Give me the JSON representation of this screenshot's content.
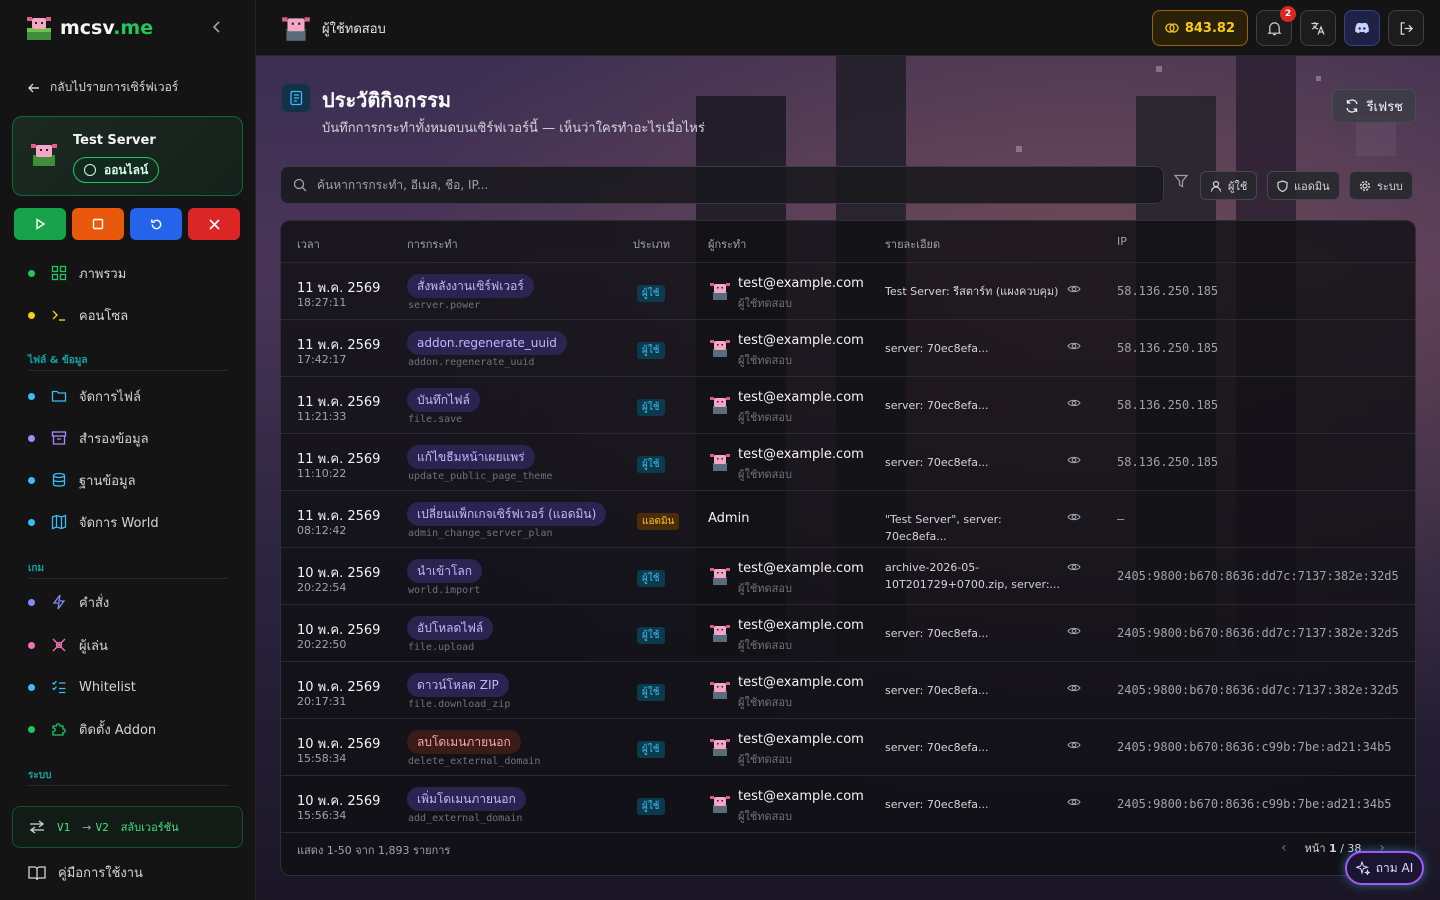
{
  "brand": {
    "name": "mcsv",
    "tld": ".me"
  },
  "sidebar": {
    "back_label": "กลับไปรายการเซิร์ฟเวอร์",
    "server": {
      "name": "Test Server",
      "status": "ออนไลน์"
    },
    "nav_main": [
      {
        "label": "ภาพรวม",
        "icon": "dashboard-icon",
        "dot": "#22c55e"
      },
      {
        "label": "คอนโซล",
        "icon": "terminal-icon",
        "dot": "#facc15"
      }
    ],
    "section_files": "ไฟล์ & ข้อมูล",
    "nav_files": [
      {
        "label": "จัดการไฟล์",
        "icon": "folder-icon",
        "dot": "#38bdf8"
      },
      {
        "label": "สำรองข้อมูล",
        "icon": "archive-icon",
        "dot": "#a78bfa"
      },
      {
        "label": "ฐานข้อมูล",
        "icon": "database-icon",
        "dot": "#38bdf8"
      },
      {
        "label": "จัดการ World",
        "icon": "map-icon",
        "dot": "#38bdf8"
      }
    ],
    "section_game": "เกม",
    "nav_game": [
      {
        "label": "คำสั่ง",
        "icon": "lightning-icon",
        "dot": "#818cf8"
      },
      {
        "label": "ผู้เล่น",
        "icon": "players-icon",
        "dot": "#f472b6"
      },
      {
        "label": "Whitelist",
        "icon": "checklist-icon",
        "dot": "#38bdf8"
      },
      {
        "label": "ติดตั้ง Addon",
        "icon": "puzzle-icon",
        "dot": "#22c55e"
      }
    ],
    "section_system": "ระบบ",
    "version_switch": {
      "from": "V1",
      "to": "V2",
      "label": "สลับเวอร์ชัน"
    },
    "guide_label": "คู่มือการใช้งาน"
  },
  "topbar": {
    "title": "ผู้ใช้ทดสอบ",
    "credit": "843.82",
    "notifications": "2"
  },
  "page": {
    "title": "ประวัติกิจกรรม",
    "subtitle": "บันทึกการกระทำทั้งหมดบนเซิร์ฟเวอร์นี้ — เห็นว่าใครทำอะไรเมื่อไหร่",
    "refresh_label": "รีเฟรช",
    "search_placeholder": "ค้นหาการกระทำ, อีเมล, ชื่อ, IP...",
    "filters": {
      "user": "ผู้ใช้",
      "admin": "แอดมิน",
      "system": "ระบบ"
    }
  },
  "table": {
    "headers": {
      "time": "เวลา",
      "action": "การกระทำ",
      "type": "ประเภท",
      "actor": "ผู้กระทำ",
      "detail": "รายละเอียด",
      "ip": "IP"
    },
    "rows": [
      {
        "date": "11 พ.ค. 2569",
        "time": "18:27:11",
        "action": "สั่งพลังงานเซิร์ฟเวอร์",
        "code": "server.power",
        "type": "ผู้ใช้",
        "email": "test@example.com",
        "user": "ผู้ใช้ทดสอบ",
        "detail": "Test Server: รีสตาร์ท (แผงควบคุม)",
        "ip": "58.136.250.185"
      },
      {
        "date": "11 พ.ค. 2569",
        "time": "17:42:17",
        "action": "addon.regenerate_uuid",
        "code": "addon.regenerate_uuid",
        "type": "ผู้ใช้",
        "email": "test@example.com",
        "user": "ผู้ใช้ทดสอบ",
        "detail": "server: 70ec8efa...",
        "ip": "58.136.250.185"
      },
      {
        "date": "11 พ.ค. 2569",
        "time": "11:21:33",
        "action": "บันทึกไฟล์",
        "code": "file.save",
        "type": "ผู้ใช้",
        "email": "test@example.com",
        "user": "ผู้ใช้ทดสอบ",
        "detail": "server: 70ec8efa...",
        "ip": "58.136.250.185"
      },
      {
        "date": "11 พ.ค. 2569",
        "time": "11:10:22",
        "action": "แก้ไขธีมหน้าเผยแพร่",
        "code": "update_public_page_theme",
        "type": "ผู้ใช้",
        "email": "test@example.com",
        "user": "ผู้ใช้ทดสอบ",
        "detail": "server: 70ec8efa...",
        "ip": "58.136.250.185"
      },
      {
        "date": "11 พ.ค. 2569",
        "time": "08:12:42",
        "action": "เปลี่ยนแพ็กเกจเซิร์ฟเวอร์ (แอดมิน)",
        "code": "admin_change_server_plan",
        "type": "แอดมิน",
        "actor": "Admin",
        "detail": "\"Test Server\", server: 70ec8efa...",
        "ip": "–"
      },
      {
        "date": "10 พ.ค. 2569",
        "time": "20:22:54",
        "action": "นำเข้าโลก",
        "code": "world.import",
        "type": "ผู้ใช้",
        "email": "test@example.com",
        "user": "ผู้ใช้ทดสอบ",
        "detail": "archive-2026-05-10T201729+0700.zip, server:...",
        "ip": "2405:9800:b670:8636:dd7c:7137:382e:32d5"
      },
      {
        "date": "10 พ.ค. 2569",
        "time": "20:22:50",
        "action": "อัปโหลดไฟล์",
        "code": "file.upload",
        "type": "ผู้ใช้",
        "email": "test@example.com",
        "user": "ผู้ใช้ทดสอบ",
        "detail": "server: 70ec8efa...",
        "ip": "2405:9800:b670:8636:dd7c:7137:382e:32d5"
      },
      {
        "date": "10 พ.ค. 2569",
        "time": "20:17:31",
        "action": "ดาวน์โหลด ZIP",
        "code": "file.download_zip",
        "type": "ผู้ใช้",
        "email": "test@example.com",
        "user": "ผู้ใช้ทดสอบ",
        "detail": "server: 70ec8efa...",
        "ip": "2405:9800:b670:8636:dd7c:7137:382e:32d5"
      },
      {
        "date": "10 พ.ค. 2569",
        "time": "15:58:34",
        "action": "ลบโดเมนภายนอก",
        "code": "delete_external_domain",
        "type": "ผู้ใช้",
        "email": "test@example.com",
        "user": "ผู้ใช้ทดสอบ",
        "detail": "server: 70ec8efa...",
        "ip": "2405:9800:b670:8636:c99b:7be:ad21:34b5"
      },
      {
        "date": "10 พ.ค. 2569",
        "time": "15:56:34",
        "action": "เพิ่มโดเมนภายนอก",
        "code": "add_external_domain",
        "type": "ผู้ใช้",
        "email": "test@example.com",
        "user": "ผู้ใช้ทดสอบ",
        "detail": "server: 70ec8efa...",
        "ip": "2405:9800:b670:8636:c99b:7be:ad21:34b5"
      }
    ],
    "footer_info": "แสดง 1-50 จาก 1,893 รายการ",
    "page_prefix": "หน้า",
    "page_current": "1",
    "page_total": "/ 38"
  },
  "ask_ai": "ถาม AI"
}
